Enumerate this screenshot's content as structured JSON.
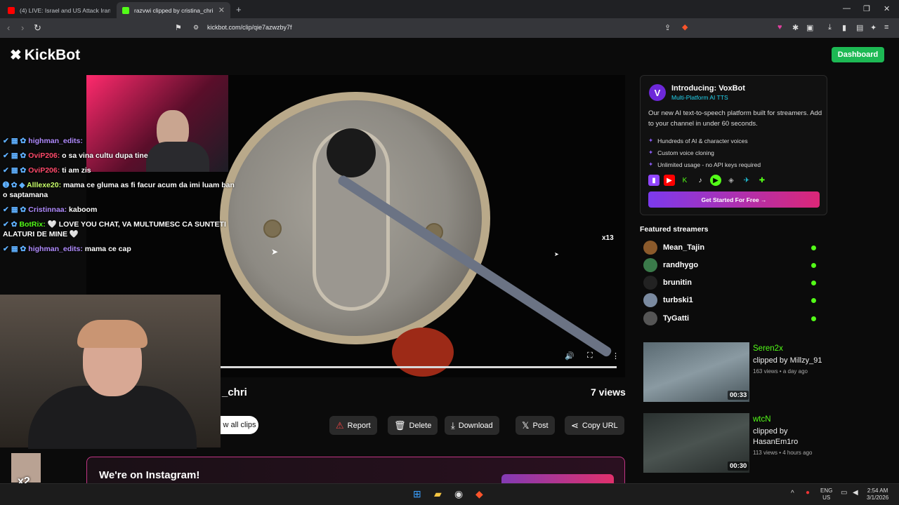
{
  "browser": {
    "tabs": [
      {
        "title": "(4) LIVE: Israel and US Attack Iran - N"
      },
      {
        "title": "razvwi clipped by cristina_chri"
      }
    ],
    "new_tab": "+",
    "url": "kickbot.com/clip/qie7azwzby7f"
  },
  "header": {
    "logo": "KickBot",
    "dashboard": "Dashboard"
  },
  "chat": [
    {
      "user": "highman_edits:",
      "msg": ""
    },
    {
      "user": "OviP206:",
      "msg": "o sa vina cultu dupa tine"
    },
    {
      "user": "OviP206:",
      "msg": "ti am zis"
    },
    {
      "user": "Alllexe20:",
      "msg": "mama ce gluma as fi facur acum da imi luam ban o saptamana"
    },
    {
      "user": "Cristinnaa:",
      "msg": "kaboom"
    },
    {
      "user": "BotRix:",
      "msg": "🤍 LOVE YOU CHAT, VA MULTUMESC CA SUNTETI ALATURI DE MINE 🤍"
    },
    {
      "user": "highman_edits:",
      "msg": "mama ce cap"
    }
  ],
  "video": {
    "multiplier": "x13",
    "avatar_multiplier": "x2"
  },
  "clip": {
    "title_fragment": "_chri",
    "views": "7 views",
    "all_clips": "w all clips",
    "actions": [
      "Report",
      "Delete",
      "Download",
      "Post",
      "Copy URL"
    ]
  },
  "instagram": {
    "title": "We're on Instagram!"
  },
  "voxbot": {
    "title": "Introducing: VoxBot",
    "subtitle": "Multi-Platform AI TTS",
    "description": "Our new AI text-to-speech platform built for streamers. Add to your channel in under 60 seconds.",
    "features": [
      "Hundreds of AI & character voices",
      "Custom voice cloning",
      "Unlimited usage - no API keys required"
    ],
    "cta": "Get Started For Free →"
  },
  "featured": {
    "heading": "Featured streamers",
    "streamers": [
      "Mean_Tajin",
      "randhygo",
      "brunitin",
      "turbski1",
      "TyGatti"
    ]
  },
  "side_clips": [
    {
      "streamer": "Seren2x",
      "by": "clipped by Millzy_91",
      "meta": "163 views • a day ago",
      "duration": "00:33"
    },
    {
      "streamer": "wtcN",
      "by": "clipped by HasanEm1ro",
      "meta": "113 views • 4 hours ago",
      "duration": "00:30"
    }
  ],
  "taskbar": {
    "lang": "ENG",
    "region": "US",
    "time": "2:54 AM",
    "date": "3/1/2026"
  },
  "colors": {
    "accent": "#1db954",
    "kick_green": "#53fc18",
    "vox_purple": "#7c3aed"
  }
}
